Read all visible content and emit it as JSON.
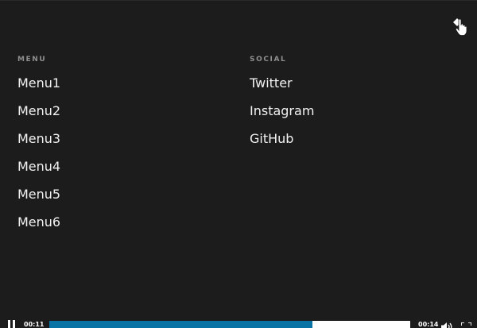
{
  "nav": {
    "close_icon": "hand-pointer-icon",
    "menu": {
      "heading": "MENU",
      "items": [
        {
          "label": "Menu1"
        },
        {
          "label": "Menu2"
        },
        {
          "label": "Menu3"
        },
        {
          "label": "Menu4"
        },
        {
          "label": "Menu5"
        },
        {
          "label": "Menu6"
        }
      ]
    },
    "social": {
      "heading": "SOCIAL",
      "items": [
        {
          "label": "Twitter"
        },
        {
          "label": "Instagram"
        },
        {
          "label": "GitHub"
        }
      ]
    }
  },
  "player": {
    "current_time": "00:11",
    "duration": "00:14",
    "progress": 0.73,
    "progress_color": "#0a73a6",
    "track_color": "#ffffff",
    "icons": {
      "play": "pause-icon",
      "volume": "volume-icon",
      "fullscreen": "fullscreen-icon"
    }
  },
  "colors": {
    "background": "#1c1c1c",
    "heading": "#8f8f8f",
    "link": "#f2f2f2"
  }
}
